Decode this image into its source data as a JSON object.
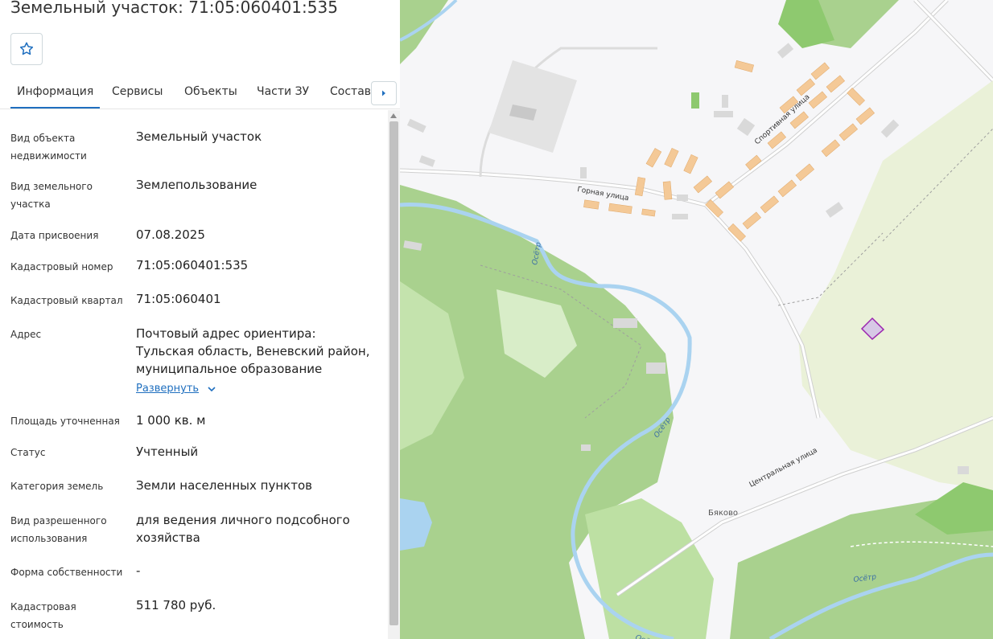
{
  "title": "Земельный участок: 71:05:060401:535",
  "tabs": [
    "Информация",
    "Сервисы",
    "Объекты",
    "Части ЗУ",
    "Состав"
  ],
  "fields": [
    {
      "label": "Вид объекта недвижимости",
      "value": "Земельный участок"
    },
    {
      "label": "Вид земельного участка",
      "value": "Землепользование"
    },
    {
      "label": "Дата присвоения",
      "value": "07.08.2025"
    },
    {
      "label": "Кадастровый номер",
      "value": "71:05:060401:535"
    },
    {
      "label": "Кадастровый квартал",
      "value": "71:05:060401"
    },
    {
      "label": "Адрес",
      "value": "Почтовый адрес ориентира: Тульская область, Веневский район, муниципальное образование"
    },
    {
      "label": "Площадь уточненная",
      "value": "1 000 кв. м"
    },
    {
      "label": "Статус",
      "value": "Учтенный"
    },
    {
      "label": "Категория земель",
      "value": "Земли населенных пунктов"
    },
    {
      "label": "Вид разрешенного использования",
      "value": "для ведения личного подсобного хозяйства"
    },
    {
      "label": "Форма собственности",
      "value": "-"
    },
    {
      "label": "Кадастровая стоимость",
      "value": "511 780 руб."
    }
  ],
  "expand_label": "Развернуть",
  "map": {
    "streets": {
      "gornaya": "Горная улица",
      "sportivnaya": "Спортивная улица",
      "centralnaya": "Центральная улица"
    },
    "river": "Осётр",
    "village": "Бяково",
    "colors": {
      "forest": "#a9d18e",
      "river": "#aad3f0",
      "building": "#f4c997",
      "parcel": "#9c27b0",
      "accent": "#1f6fbf"
    }
  }
}
